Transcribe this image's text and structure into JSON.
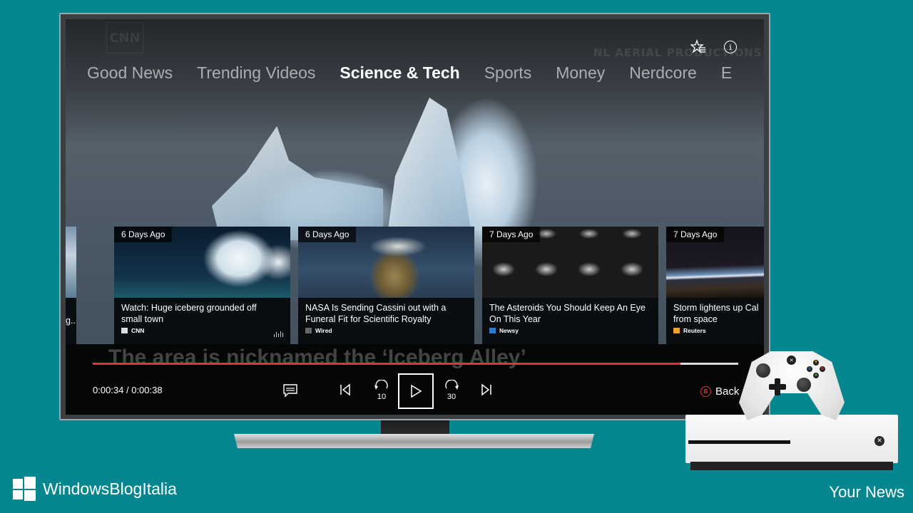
{
  "app": {
    "name": "Your News",
    "brand": "WindowsBlogItalia"
  },
  "header": {
    "favorites_icon": "star-list-icon",
    "info_icon": "info-icon",
    "watermarks": {
      "channel": "CNN",
      "credit": "NL AERIAL PRODUCTIONS"
    }
  },
  "tabs": [
    {
      "label": "Good News",
      "active": false
    },
    {
      "label": "Trending Videos",
      "active": false
    },
    {
      "label": "Science & Tech",
      "active": true
    },
    {
      "label": "Sports",
      "active": false
    },
    {
      "label": "Money",
      "active": false
    },
    {
      "label": "Nerdcore",
      "active": false
    },
    {
      "label": "E",
      "active": false
    }
  ],
  "cards": {
    "partial": {
      "title_tail": "g..."
    },
    "items": [
      {
        "age": "6 Days Ago",
        "title_line1": "Watch: Huge iceberg grounded off",
        "title_line2": "small town",
        "source": "CNN",
        "playing": true
      },
      {
        "age": "6 Days Ago",
        "title_line1": "NASA Is Sending Cassini out with a",
        "title_line2": "Funeral Fit for Scientific Royalty",
        "source": "Wired",
        "playing": false
      },
      {
        "age": "7 Days Ago",
        "title_line1": "The Asteroids You Should Keep An Eye",
        "title_line2": "On This Year",
        "source": "Newsy",
        "playing": false
      },
      {
        "age": "7 Days Ago",
        "title_line1": "Storm lightens up Califo",
        "title_line2": "from space",
        "source": "Reuters",
        "playing": false
      }
    ]
  },
  "player": {
    "subtitle": "The area is nicknamed the ‘Iceberg Alley’",
    "current_time": "0:00:34",
    "total_time": "0:00:38",
    "time_display": "0:00:34 / 0:00:38",
    "progress_fraction": 0.91,
    "progress_color": "#e0343a",
    "controls": {
      "captions": "captions-icon",
      "previous": "skip-previous-icon",
      "rewind_label": "10",
      "play": "play-icon",
      "forward_label": "30",
      "next": "skip-next-icon"
    },
    "back_button_key": "B",
    "back_label": "Back"
  },
  "colors": {
    "background": "#06878f",
    "accent_red": "#e0343a"
  }
}
